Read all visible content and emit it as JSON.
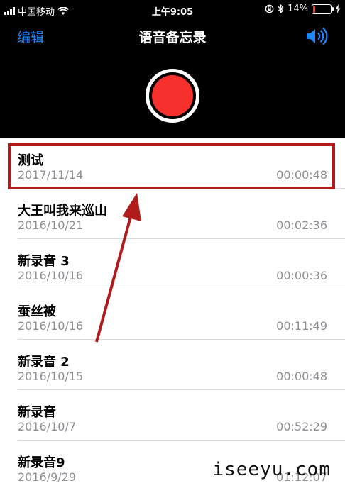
{
  "status_bar": {
    "carrier": "中国移动",
    "time": "上午9:05",
    "battery": "14%",
    "battery_level": 0.14
  },
  "nav": {
    "edit_label": "编辑",
    "title": "语音备忘录",
    "speaker_icon": "speaker-icon"
  },
  "recordings": [
    {
      "name": "测试",
      "date": "2017/11/14",
      "duration": "00:00:48"
    },
    {
      "name": "大王叫我来巡山",
      "date": "2016/10/21",
      "duration": "00:02:36"
    },
    {
      "name": "新录音 3",
      "date": "2016/10/16",
      "duration": "00:00:36"
    },
    {
      "name": "蚕丝被",
      "date": "2016/10/16",
      "duration": "00:11:49"
    },
    {
      "name": "新录音 2",
      "date": "2016/10/15",
      "duration": "00:00:48"
    },
    {
      "name": "新录音",
      "date": "2016/10/7",
      "duration": "00:52:29"
    },
    {
      "name": "新录音9",
      "date": "2016/9/29",
      "duration": "01:12:07"
    }
  ],
  "watermark": "iseeyu.com",
  "colors": {
    "accent": "#1e88ff",
    "record": "#f5302d",
    "annotation": "#b01c1c",
    "battery_low": "#ff3b30"
  }
}
